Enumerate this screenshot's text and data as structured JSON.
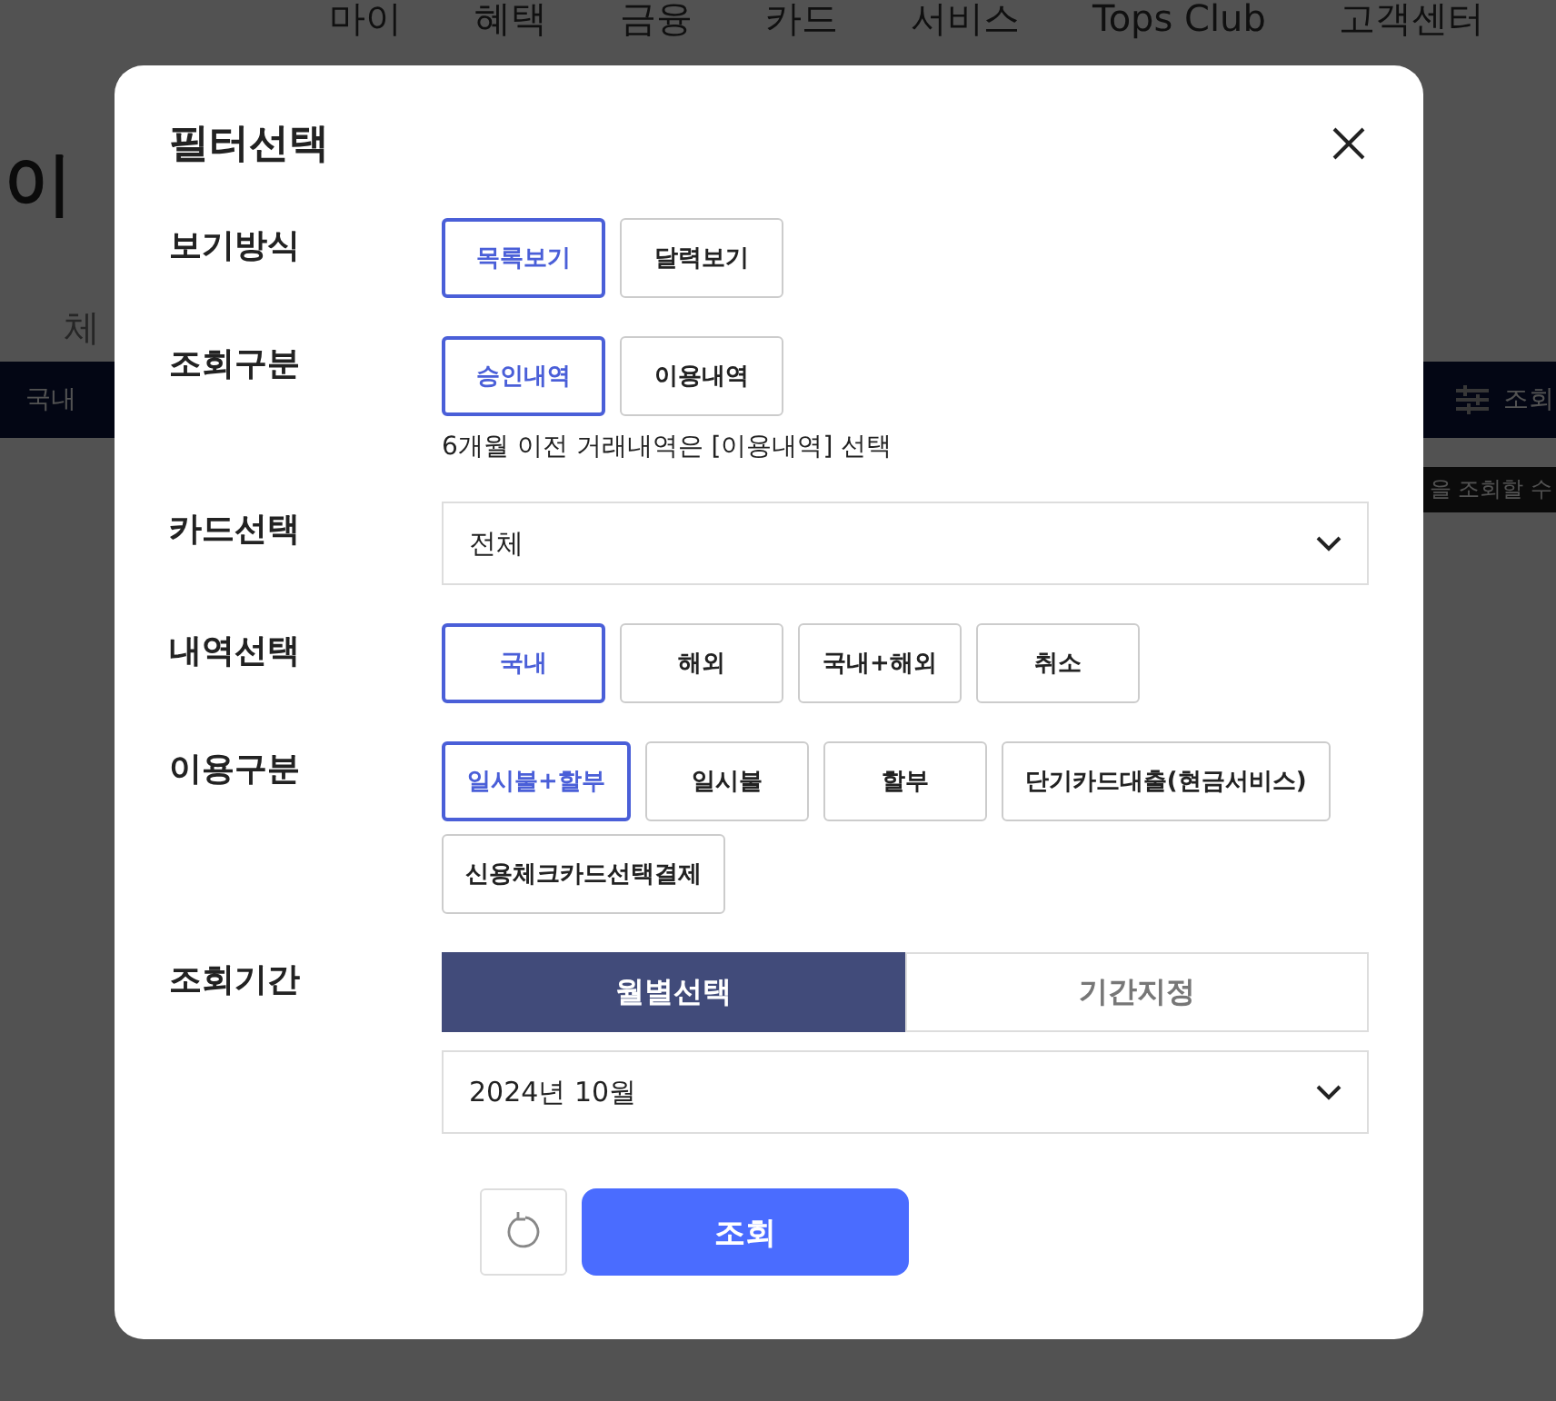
{
  "background": {
    "nav": [
      "마이",
      "혜택",
      "금융",
      "카드",
      "서비스",
      "Tops Club",
      "고객센터"
    ],
    "heading": "이",
    "tab": "체",
    "bar_label": "국내",
    "filter_label": "조회",
    "tooltip": "을 조회할 수"
  },
  "modal": {
    "title": "필터선택",
    "sections": [
      {
        "kind": "options",
        "label": "보기방식",
        "options": [
          {
            "label": "목록보기",
            "selected": true
          },
          {
            "label": "달력보기",
            "selected": false
          }
        ]
      },
      {
        "kind": "options",
        "label": "조회구분",
        "options": [
          {
            "label": "승인내역",
            "selected": true
          },
          {
            "label": "이용내역",
            "selected": false
          }
        ],
        "note": "6개월 이전 거래내역은 [이용내역] 선택"
      },
      {
        "kind": "select",
        "label": "카드선택",
        "value": "전체"
      },
      {
        "kind": "options",
        "label": "내역선택",
        "options": [
          {
            "label": "국내",
            "selected": true
          },
          {
            "label": "해외",
            "selected": false
          },
          {
            "label": "국내+해외",
            "selected": false
          },
          {
            "label": "취소",
            "selected": false
          }
        ]
      },
      {
        "kind": "options",
        "label": "이용구분",
        "options": [
          {
            "label": "일시불+할부",
            "selected": true
          },
          {
            "label": "일시불",
            "selected": false
          },
          {
            "label": "할부",
            "selected": false
          },
          {
            "label": "단기카드대출(현금서비스)",
            "selected": false
          },
          {
            "label": "신용체크카드선택결제",
            "selected": false
          }
        ]
      },
      {
        "kind": "period",
        "label": "조회기간",
        "tabs": [
          {
            "label": "월별선택",
            "selected": true
          },
          {
            "label": "기간지정",
            "selected": false
          }
        ],
        "value": "2024년 10월"
      }
    ],
    "submit": "조회"
  }
}
